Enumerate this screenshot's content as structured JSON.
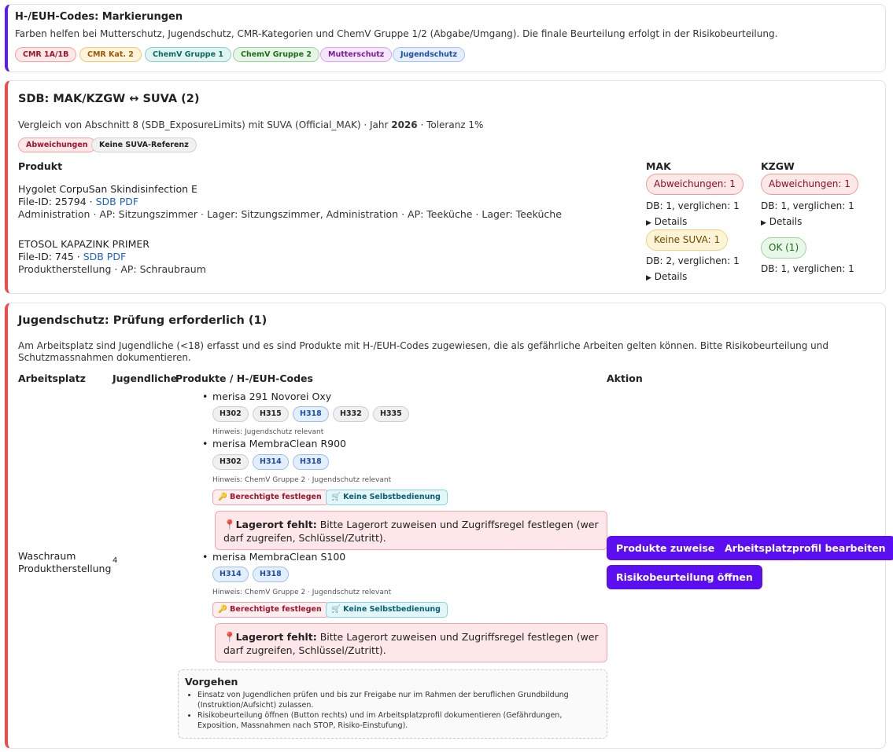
{
  "legend": {
    "title": "H-/EUH-Codes: Markierungen",
    "description": "Farben helfen bei Mutterschutz, Jugendschutz, CMR-Kategorien und ChemV Gruppe 1/2 (Abgabe/Umgang). Die finale Beurteilung erfolgt in der Risikobeurteilung.",
    "pills": [
      "CMR 1A/1B",
      "CMR Kat. 2",
      "ChemV Gruppe 1",
      "ChemV Gruppe 2",
      "Mutterschutz",
      "Jugendschutz"
    ]
  },
  "sdb": {
    "title": "SDB: MAK/KZGW ↔ SUVA (2)",
    "desc_prefix": "Vergleich von Abschnitt 8 (SDB_ExposureLimits) mit SUVA (Official_MAK) · Jahr ",
    "year": "2026",
    "desc_suffix": " · Toleranz 1%",
    "badges": [
      "Abweichungen",
      "Keine SUVA-Referenz"
    ],
    "col_product": "Produkt",
    "col_mak": "MAK",
    "col_kzgw": "KZGW",
    "products": [
      {
        "name": "Hygolet CorpuSan Skindisinfection E",
        "file_id": "File-ID: 25794 · ",
        "pdf": "SDB PDF",
        "location": "Administration · AP: Sitzungszimmer · Lager: Sitzungszimmer, Administration · AP: Teeküche · Lager: Teeküche",
        "mak_status": "Abweichungen: 1",
        "mak_db": "DB: 1, verglichen: 1",
        "mak_details": "Details",
        "kzgw_status": "Abweichungen: 1",
        "kzgw_db": "DB: 1, verglichen: 1",
        "kzgw_details": "Details"
      },
      {
        "name": "ETOSOL KAPAZINK PRIMER",
        "file_id": "File-ID: 745 · ",
        "pdf": "SDB PDF",
        "location": "Produktherstellung · AP: Schraubraum",
        "mak_status": "Keine SUVA: 1",
        "mak_db": "DB: 2, verglichen: 1",
        "mak_details": "Details",
        "kzgw_status": "OK (1)",
        "kzgw_db": "DB: 1, verglichen: 1"
      }
    ]
  },
  "js": {
    "title": "Jugendschutz: Prüfung erforderlich (1)",
    "description": "Am Arbeitsplatz sind Jugendliche (<18) erfasst und es sind Produkte mit H-/EUH-Codes zugewiesen, die als gefährliche Arbeiten gelten können. Bitte Risikobeurteilung und Schutzmassnahmen dokumentieren.",
    "headers": {
      "workplace": "Arbeitsplatz",
      "youth": "Jugendliche",
      "products": "Produkte / H-/EUH-Codes",
      "action": "Aktion"
    },
    "workplace_line1": "Waschraum",
    "workplace_line2": "Produktherstellung",
    "youth_count": "4",
    "products": [
      {
        "name": "merisa 291 Novorei Oxy",
        "codes": [
          "H302",
          "H315",
          "H318",
          "H332",
          "H335"
        ],
        "hint": "Hinweis: Jugendschutz relevant"
      },
      {
        "name": "merisa MembraClean R900",
        "codes": [
          "H302",
          "H314",
          "H318"
        ],
        "hint": "Hinweis: ChemV Gruppe 2 · Jugendschutz relevant",
        "tag1": "Berechtigte festlegen",
        "tag2": "Keine Selbstbedienung",
        "alert_bold": "Lagerort fehlt:",
        "alert_text": " Bitte Lagerort zuweisen und Zugriffsregel festlegen (wer darf zugreifen, Schlüssel/Zutritt)."
      },
      {
        "name": "merisa MembraClean S100",
        "codes": [
          "H314",
          "H318"
        ],
        "hint": "Hinweis: ChemV Gruppe 2 · Jugendschutz relevant",
        "tag1": "Berechtigte festlegen",
        "tag2": "Keine Selbstbedienung",
        "alert_bold": "Lagerort fehlt:",
        "alert_text": " Bitte Lagerort zuweisen und Zugriffsregel festlegen (wer darf zugreifen, Schlüssel/Zutritt)."
      }
    ],
    "vorgehen": {
      "title": "Vorgehen",
      "items": [
        "Einsatz von Jugendlichen prüfen und bis zur Freigabe nur im Rahmen der beruflichen Grundbildung (Instruktion/Aufsicht) zulassen.",
        "Risikobeurteilung öffnen (Button rechts) und im Arbeitsplatzprofil dokumentieren (Gefährdungen, Exposition, Massnahmen nach STOP, Risiko-Einstufung)."
      ]
    },
    "buttons": {
      "assign": "Produkte zuweisen",
      "profile": "Arbeitsplatzprofil bearbeiten",
      "risk": "Risikobeurteilung öffnen"
    }
  }
}
